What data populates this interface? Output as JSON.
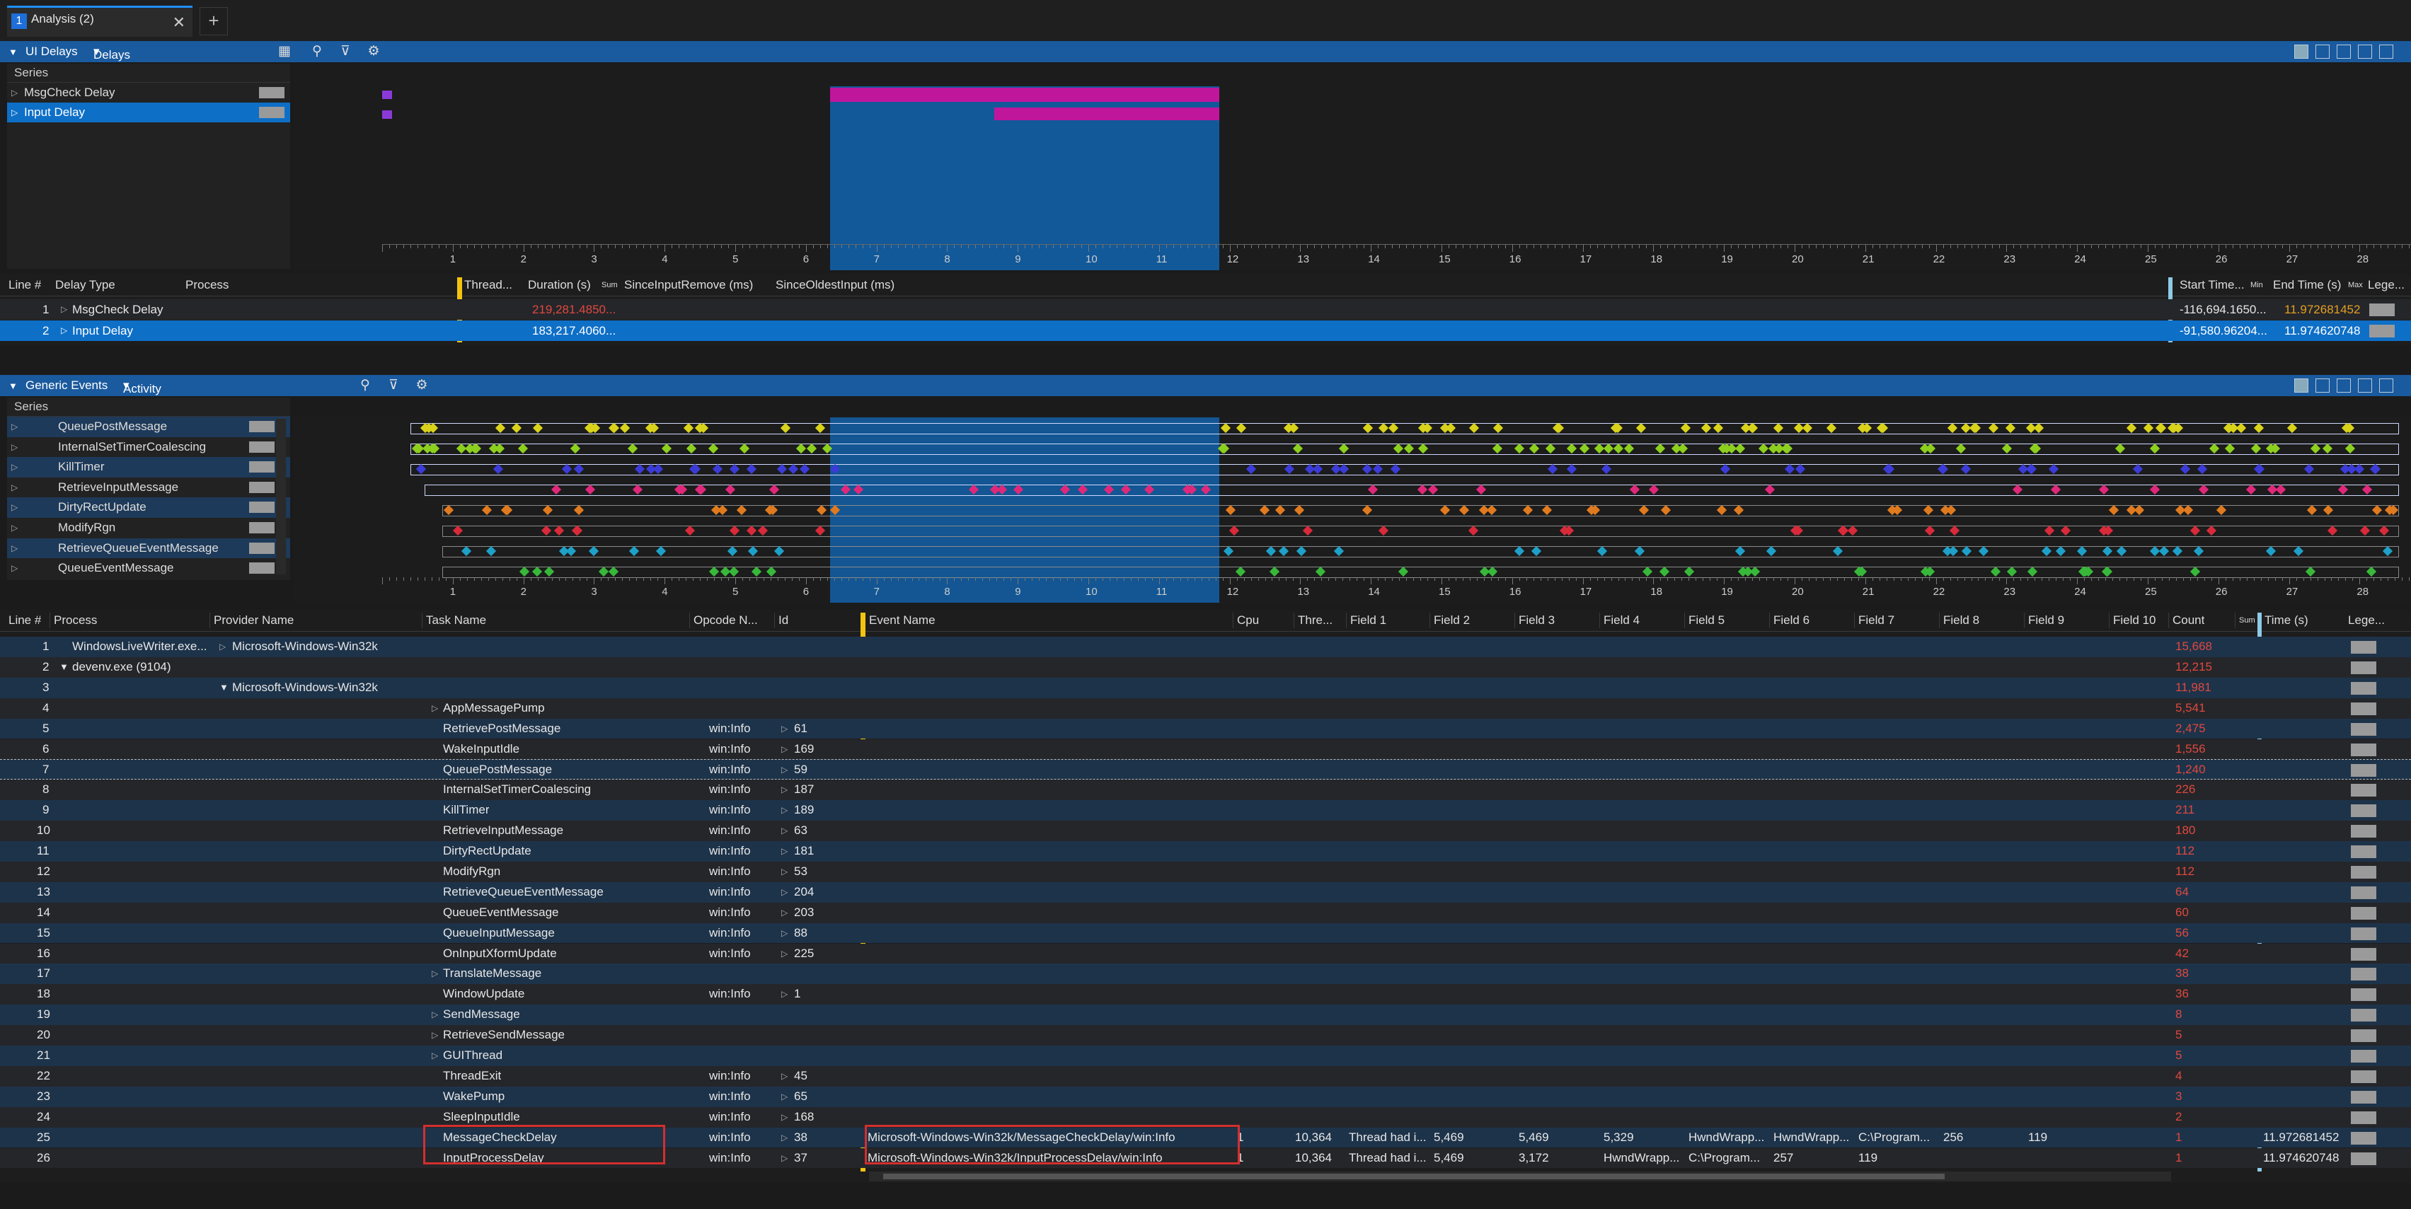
{
  "tabs": {
    "number": "1",
    "title": "Analysis (2)",
    "close_glyph": "✕",
    "add_glyph": "+"
  },
  "ui_delays": {
    "panel_title": "UI Delays",
    "preset": "Delays By Process, Type *",
    "series_header": "Series",
    "series": [
      "MsgCheck Delay",
      "Input Delay"
    ],
    "bar_color": "#c0169c",
    "selection_color": "#0e6fc7",
    "axis_ticks": [
      "1",
      "2",
      "3",
      "4",
      "5",
      "6",
      "7",
      "8",
      "9",
      "10",
      "11",
      "12",
      "13",
      "14",
      "15",
      "16",
      "17",
      "18",
      "19",
      "20",
      "21",
      "22",
      "23",
      "24",
      "25",
      "26",
      "27",
      "28"
    ],
    "table": {
      "headers": [
        "Line #",
        "Delay Type",
        "Process",
        "Thread...",
        "Duration (s)",
        "Sum",
        "SinceInputRemove (ms)",
        "SinceOldestInput (ms)",
        "Start Time...",
        "Min",
        "End Time (s)",
        "Max",
        "Lege..."
      ],
      "rows": [
        {
          "line": "1",
          "type": "MsgCheck Delay",
          "duration": "219,281.4850...",
          "start": "-116,694.1650...",
          "end": "11.972681452"
        },
        {
          "line": "2",
          "type": "Input Delay",
          "duration": "183,217.4060...",
          "start": "-91,580.96204...",
          "end": "11.974620748"
        }
      ]
    }
  },
  "generic_events": {
    "panel_title": "Generic Events",
    "preset": "Activity by Provider, Task, Opcode *",
    "series_header": "Series",
    "series": [
      {
        "name": "QueuePostMessage",
        "color": "#d9d21a"
      },
      {
        "name": "InternalSetTimerCoalescing",
        "color": "#8ccf1e"
      },
      {
        "name": "KillTimer",
        "color": "#3b3bd8"
      },
      {
        "name": "RetrieveInputMessage",
        "color": "#e0287a"
      },
      {
        "name": "DirtyRectUpdate",
        "color": "#e07a1e"
      },
      {
        "name": "ModifyRgn",
        "color": "#d82a3a"
      },
      {
        "name": "RetrieveQueueEventMessage",
        "color": "#1ea0c8"
      },
      {
        "name": "QueueEventMessage",
        "color": "#38b83a"
      }
    ],
    "table": {
      "headers": [
        "Line #",
        "Process",
        "Provider Name",
        "Task Name",
        "Opcode N...",
        "Id",
        "Event Name",
        "Cpu",
        "Thre...",
        "Field 1",
        "Field 2",
        "Field 3",
        "Field 4",
        "Field 5",
        "Field 6",
        "Field 7",
        "Field 8",
        "Field 9",
        "Field 10",
        "Count",
        "Sum",
        "Time (s)",
        "Lege..."
      ],
      "rows": [
        {
          "line": "1",
          "process": "WindowsLiveWriter.exe...",
          "provider": "Microsoft-Windows-Win32k",
          "task": "",
          "opcode": "",
          "id": "",
          "event": "",
          "count": "15,668"
        },
        {
          "line": "2",
          "process": "devenv.exe (9104)",
          "provider": "",
          "task": "",
          "opcode": "",
          "id": "",
          "event": "",
          "count": "12,215"
        },
        {
          "line": "3",
          "process": "",
          "provider": "Microsoft-Windows-Win32k",
          "task": "",
          "opcode": "",
          "id": "",
          "event": "",
          "count": "11,981"
        },
        {
          "line": "4",
          "process": "",
          "provider": "",
          "task": "AppMessagePump",
          "opcode": "",
          "id": "",
          "event": "",
          "count": "5,541"
        },
        {
          "line": "5",
          "process": "",
          "provider": "",
          "task": "RetrievePostMessage",
          "opcode": "win:Info",
          "id": "61",
          "event": "",
          "count": "2,475"
        },
        {
          "line": "6",
          "process": "",
          "provider": "",
          "task": "WakeInputIdle",
          "opcode": "win:Info",
          "id": "169",
          "event": "",
          "count": "1,556"
        },
        {
          "line": "7",
          "process": "",
          "provider": "",
          "task": "QueuePostMessage",
          "opcode": "win:Info",
          "id": "59",
          "event": "",
          "count": "1,240"
        },
        {
          "line": "8",
          "process": "",
          "provider": "",
          "task": "InternalSetTimerCoalescing",
          "opcode": "win:Info",
          "id": "187",
          "event": "",
          "count": "226"
        },
        {
          "line": "9",
          "process": "",
          "provider": "",
          "task": "KillTimer",
          "opcode": "win:Info",
          "id": "189",
          "event": "",
          "count": "211"
        },
        {
          "line": "10",
          "process": "",
          "provider": "",
          "task": "RetrieveInputMessage",
          "opcode": "win:Info",
          "id": "63",
          "event": "",
          "count": "180"
        },
        {
          "line": "11",
          "process": "",
          "provider": "",
          "task": "DirtyRectUpdate",
          "opcode": "win:Info",
          "id": "181",
          "event": "",
          "count": "112"
        },
        {
          "line": "12",
          "process": "",
          "provider": "",
          "task": "ModifyRgn",
          "opcode": "win:Info",
          "id": "53",
          "event": "",
          "count": "112"
        },
        {
          "line": "13",
          "process": "",
          "provider": "",
          "task": "RetrieveQueueEventMessage",
          "opcode": "win:Info",
          "id": "204",
          "event": "",
          "count": "64"
        },
        {
          "line": "14",
          "process": "",
          "provider": "",
          "task": "QueueEventMessage",
          "opcode": "win:Info",
          "id": "203",
          "event": "",
          "count": "60"
        },
        {
          "line": "15",
          "process": "",
          "provider": "",
          "task": "QueueInputMessage",
          "opcode": "win:Info",
          "id": "88",
          "event": "",
          "count": "56"
        },
        {
          "line": "16",
          "process": "",
          "provider": "",
          "task": "OnInputXformUpdate",
          "opcode": "win:Info",
          "id": "225",
          "event": "",
          "count": "42"
        },
        {
          "line": "17",
          "process": "",
          "provider": "",
          "task": "TranslateMessage",
          "opcode": "",
          "id": "",
          "event": "",
          "count": "38"
        },
        {
          "line": "18",
          "process": "",
          "provider": "",
          "task": "WindowUpdate",
          "opcode": "win:Info",
          "id": "1",
          "event": "",
          "count": "36"
        },
        {
          "line": "19",
          "process": "",
          "provider": "",
          "task": "SendMessage",
          "opcode": "",
          "id": "",
          "event": "",
          "count": "8"
        },
        {
          "line": "20",
          "process": "",
          "provider": "",
          "task": "RetrieveSendMessage",
          "opcode": "",
          "id": "",
          "event": "",
          "count": "5"
        },
        {
          "line": "21",
          "process": "",
          "provider": "",
          "task": "GUIThread",
          "opcode": "",
          "id": "",
          "event": "",
          "count": "5"
        },
        {
          "line": "22",
          "process": "",
          "provider": "",
          "task": "ThreadExit",
          "opcode": "win:Info",
          "id": "45",
          "event": "",
          "count": "4"
        },
        {
          "line": "23",
          "process": "",
          "provider": "",
          "task": "WakePump",
          "opcode": "win:Info",
          "id": "65",
          "event": "",
          "count": "3"
        },
        {
          "line": "24",
          "process": "",
          "provider": "",
          "task": "SleepInputIdle",
          "opcode": "win:Info",
          "id": "168",
          "event": "",
          "count": "2"
        },
        {
          "line": "25",
          "process": "",
          "provider": "",
          "task": "MessageCheckDelay",
          "opcode": "win:Info",
          "id": "38",
          "event": "Microsoft-Windows-Win32k/MessageCheckDelay/win:Info",
          "cpu": "1",
          "thread": "10,364",
          "f1": "Thread had i...",
          "f2": "5,469",
          "f3": "5,469",
          "f4": "5,329",
          "f5": "HwndWrapp...",
          "f6": "HwndWrapp...",
          "f7": "C:\\Program...",
          "f8": "256",
          "f9": "119",
          "count": "1",
          "time": "11.972681452"
        },
        {
          "line": "26",
          "process": "",
          "provider": "",
          "task": "InputProcessDelay",
          "opcode": "win:Info",
          "id": "37",
          "event": "Microsoft-Windows-Win32k/InputProcessDelay/win:Info",
          "cpu": "1",
          "thread": "10,364",
          "f1": "Thread had i...",
          "f2": "5,469",
          "f3": "3,172",
          "f4": "HwndWrapp...",
          "f5": "C:\\Program...",
          "f6": "257",
          "f7": "119",
          "count": "1",
          "time": "11.974620748"
        }
      ]
    }
  }
}
